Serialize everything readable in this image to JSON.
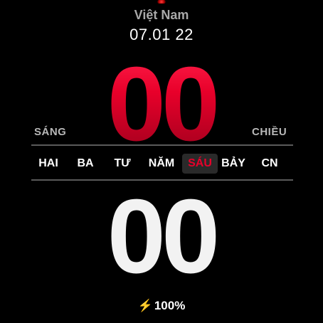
{
  "indicator": {
    "led_color": "#ff2a2a"
  },
  "header": {
    "region": "Việt Nam",
    "date": "07.01 22"
  },
  "time": {
    "hour": "00",
    "minute": "00",
    "am_label": "SÁNG",
    "pm_label": "CHIỀU",
    "hour_color": "#e8002a",
    "minute_color": "#f2f2f2"
  },
  "weekdays": {
    "items": [
      "HAI",
      "BA",
      "TƯ",
      "NĂM",
      "SÁU",
      "BẢY",
      "CN"
    ],
    "active": "SÁU",
    "active_color": "#e8002a"
  },
  "battery": {
    "icon": "lightning-bolt-icon",
    "value": "100%"
  }
}
